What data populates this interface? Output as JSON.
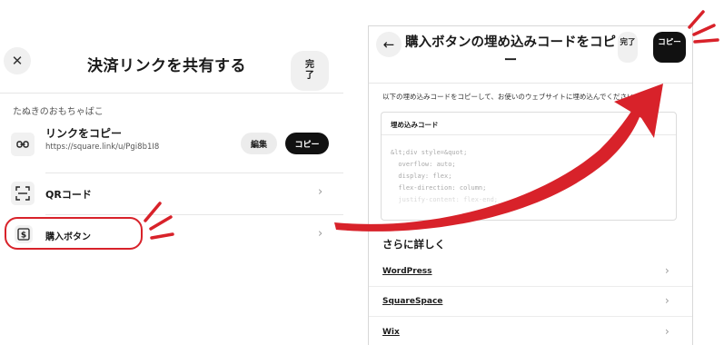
{
  "left_panel": {
    "close_icon": "close-icon",
    "title": "決済リンクを共有する",
    "done_label": "完了",
    "merchant_name": "たぬきのおもちゃばこ",
    "copy_link": {
      "title": "リンクをコピー",
      "url": "https://square.link/u/Pgi8b1I8",
      "edit_label": "編集",
      "copy_label": "コピー"
    },
    "qr_code": {
      "label": "QRコード"
    },
    "buy_button": {
      "label": "購入ボタン"
    }
  },
  "right_panel": {
    "back_icon": "arrow-left-icon",
    "title": "購入ボタンの埋め込みコードをコピー",
    "done_label": "完了",
    "copy_label": "コピー",
    "instructions": "以下の埋め込みコードをコピーして、お使いのウェブサイトに埋め込んでください",
    "code_box_title": "埋め込みコード",
    "code_lines": [
      "&lt;div style=&quot;",
      "  overflow: auto;",
      "  display: flex;",
      "  flex-direction: column;",
      "  justify-content: flex-end;"
    ],
    "more_title": "さらに詳しく",
    "links": [
      "WordPress",
      "SquareSpace",
      "Wix"
    ]
  },
  "colors": {
    "accent_red": "#d8222a",
    "primary_button": "#111111",
    "secondary_button": "#f0f0f0"
  }
}
